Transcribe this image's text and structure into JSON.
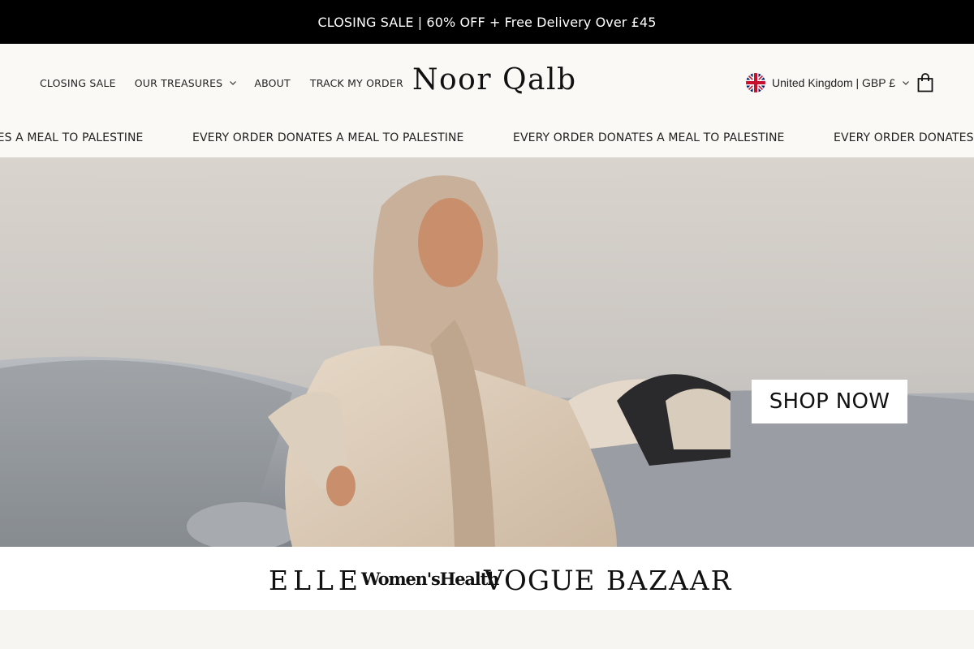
{
  "announcement": {
    "text": "CLOSING SALE | 60% OFF + Free Delivery Over £45"
  },
  "nav": {
    "items": [
      {
        "label": "CLOSING SALE"
      },
      {
        "label": "OUR TREASURES"
      },
      {
        "label": "ABOUT"
      },
      {
        "label": "TRACK MY ORDER"
      }
    ]
  },
  "brand": {
    "logo": "Noor Qalb"
  },
  "locale": {
    "label": "United Kingdom | GBP £",
    "flag": "uk-flag-icon"
  },
  "marquee": {
    "items": [
      "EVERY ORDER DONATES A MEAL TO PALESTINE",
      "EVERY ORDER DONATES A MEAL TO PALESTINE",
      "EVERY ORDER DONATES A MEAL TO PALESTINE",
      "EVERY ORDER DONATES A MEAL TO PALESTINE"
    ]
  },
  "hero": {
    "cta": "SHOP NOW"
  },
  "press": {
    "logos": [
      "ELLE",
      "Women'sHealth",
      "VOGUE",
      "BAZAAR"
    ]
  },
  "colors": {
    "announcement_bg": "#000000",
    "page_bg": "#faf9f6",
    "text": "#222222"
  }
}
